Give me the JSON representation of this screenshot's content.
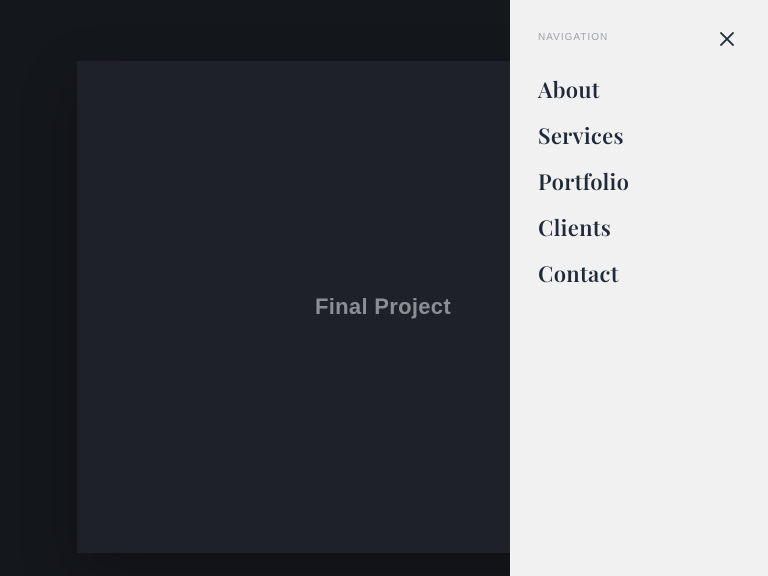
{
  "card": {
    "title": "Final Project"
  },
  "nav": {
    "eyebrow": "NAVIGATION",
    "items": [
      {
        "label": "About"
      },
      {
        "label": "Services"
      },
      {
        "label": "Portfolio"
      },
      {
        "label": "Clients"
      },
      {
        "label": "Contact"
      }
    ]
  }
}
